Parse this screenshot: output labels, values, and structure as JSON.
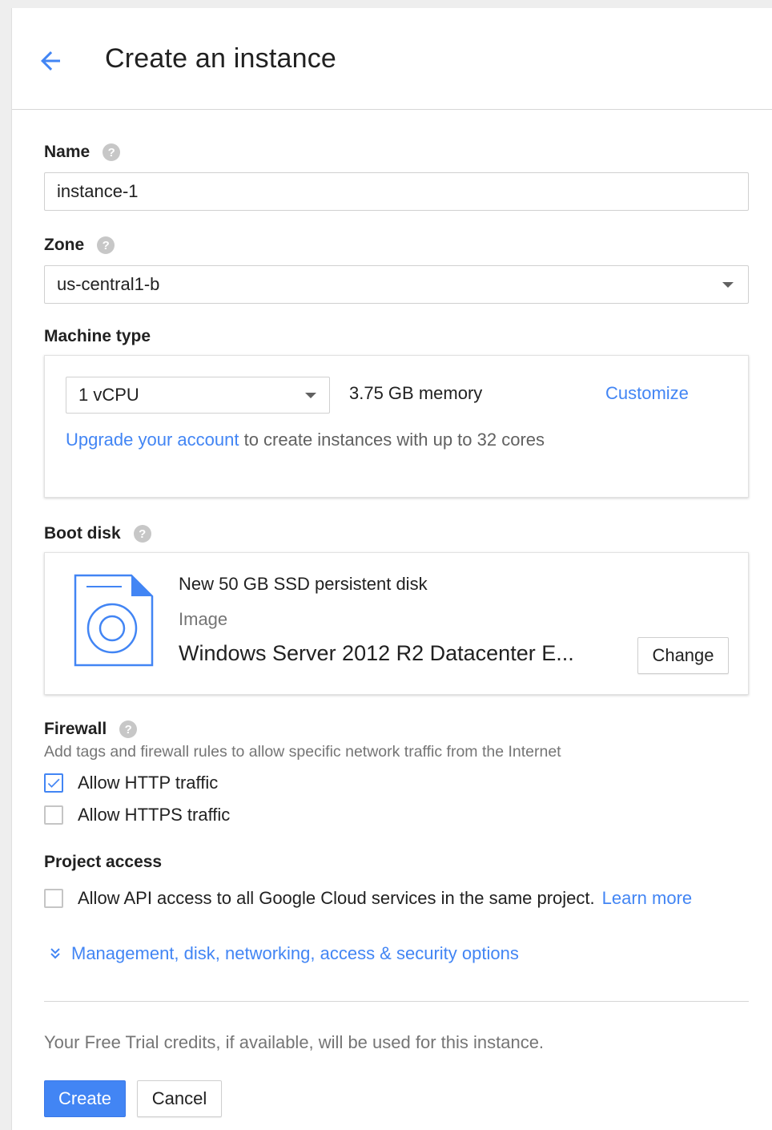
{
  "header": {
    "title": "Create an instance"
  },
  "name": {
    "label": "Name",
    "value": "instance-1"
  },
  "zone": {
    "label": "Zone",
    "value": "us-central1-b"
  },
  "machine_type": {
    "label": "Machine type",
    "cpu": "1 vCPU",
    "memory": "3.75 GB memory",
    "customize": "Customize",
    "upgrade_link": "Upgrade your account",
    "upgrade_text": " to create instances with up to 32 cores"
  },
  "boot_disk": {
    "label": "Boot disk",
    "title": "New 50 GB SSD persistent disk",
    "image_label": "Image",
    "image_name": "Windows Server 2012 R2 Datacenter E...",
    "change": "Change"
  },
  "firewall": {
    "label": "Firewall",
    "description": "Add tags and firewall rules to allow specific network traffic from the Internet",
    "http": {
      "label": "Allow HTTP traffic",
      "checked": true
    },
    "https": {
      "label": "Allow HTTPS traffic",
      "checked": false
    }
  },
  "project_access": {
    "label": "Project access",
    "api_label": "Allow API access to all Google Cloud services in the same project.",
    "learn_more": "Learn more",
    "checked": false
  },
  "management": {
    "label": "Management, disk, networking, access & security options",
    "icon": "double-chevron-down-icon"
  },
  "footer": {
    "note": "Your Free Trial credits, if available, will be used for this instance.",
    "create": "Create",
    "cancel": "Cancel"
  },
  "colors": {
    "accent": "#4285f4",
    "text": "#212121",
    "muted": "#757575",
    "border": "#d0d0d0"
  }
}
